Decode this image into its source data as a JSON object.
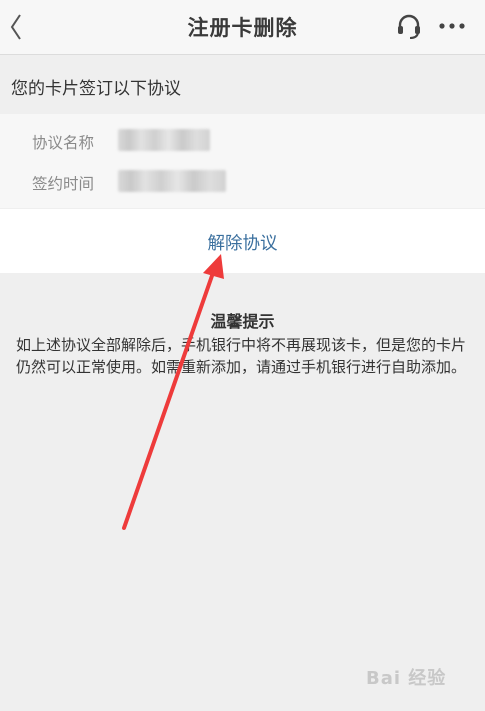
{
  "header": {
    "title": "注册卡删除",
    "back_icon": "chevron-left-icon",
    "service_icon": "headset-icon",
    "more_icon": "more-dots-icon"
  },
  "section": {
    "heading": "您的卡片签订以下协议"
  },
  "agreement": {
    "name_label": "协议名称",
    "time_label": "签约时间"
  },
  "action": {
    "remove_label": "解除协议"
  },
  "tips": {
    "title": "温馨提示",
    "body": "如上述协议全部解除后，手机银行中将不再展现该卡，但是您的卡片仍然可以正常使用。如需重新添加，请通过手机银行进行自助添加。"
  },
  "watermark": {
    "text": "Bai 经验"
  },
  "colors": {
    "accent": "#3a6f9e",
    "annotation_arrow": "#ee3b3b"
  }
}
